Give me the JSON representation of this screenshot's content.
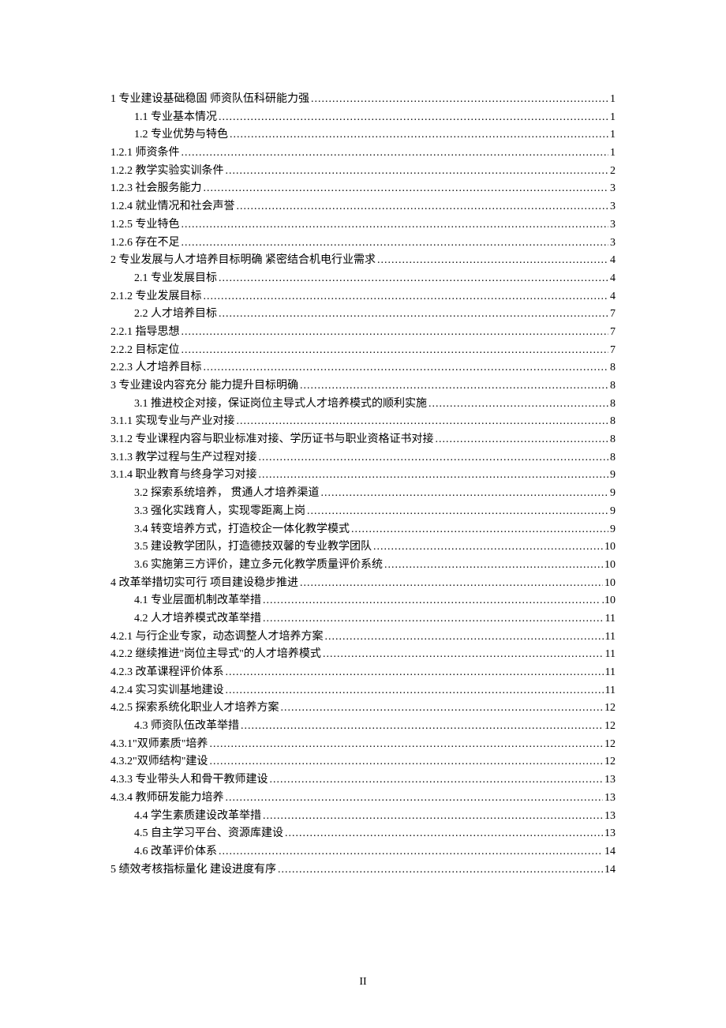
{
  "footer": "II",
  "toc": {
    "entries": [
      {
        "title": "1 专业建设基础稳固  师资队伍科研能力强",
        "page": "1",
        "indent": 0
      },
      {
        "title": "1.1 专业基本情况",
        "page": "1",
        "indent": 1
      },
      {
        "title": "1.2 专业优势与特色",
        "page": "1",
        "indent": 1
      },
      {
        "title": "1.2.1 师资条件",
        "page": "1",
        "indent": 0
      },
      {
        "title": "1.2.2 教学实验实训条件",
        "page": "2",
        "indent": 0
      },
      {
        "title": "1.2.3 社会服务能力",
        "page": "3",
        "indent": 0
      },
      {
        "title": "1.2.4 就业情况和社会声誉",
        "page": "3",
        "indent": 0
      },
      {
        "title": "1.2.5 专业特色",
        "page": "3",
        "indent": 0
      },
      {
        "title": "1.2.6 存在不足",
        "page": "3",
        "indent": 0
      },
      {
        "title": "2 专业发展与人才培养目标明确  紧密结合机电行业需求",
        "page": "4",
        "indent": 0
      },
      {
        "title": "2.1 专业发展目标",
        "page": "4",
        "indent": 1
      },
      {
        "title": "2.1.2 专业发展目标",
        "page": "4",
        "indent": 0
      },
      {
        "title": "2.2 人才培养目标",
        "page": "7",
        "indent": 1
      },
      {
        "title": "2.2.1 指导思想",
        "page": "7",
        "indent": 0
      },
      {
        "title": "2.2.2 目标定位",
        "page": "7",
        "indent": 0
      },
      {
        "title": "2.2.3 人才培养目标",
        "page": "8",
        "indent": 0
      },
      {
        "title": "3 专业建设内容充分  能力提升目标明确",
        "page": "8",
        "indent": 0
      },
      {
        "title": "3.1 推进校企对接，保证岗位主导式人才培养模式的顺利实施",
        "page": "8",
        "indent": 1
      },
      {
        "title": "3.1.1 实现专业与产业对接",
        "page": "8",
        "indent": 0
      },
      {
        "title": "3.1.2 专业课程内容与职业标准对接、学历证书与职业资格证书对接",
        "page": "8",
        "indent": 0
      },
      {
        "title": "3.1.3 教学过程与生产过程对接",
        "page": "8",
        "indent": 0
      },
      {
        "title": "3.1.4 职业教育与终身学习对接",
        "page": "9",
        "indent": 0
      },
      {
        "title": "3.2 探索系统培养，  贯通人才培养渠道",
        "page": "9",
        "indent": 1
      },
      {
        "title": "3.3 强化实践育人，实现零距离上岗",
        "page": "9",
        "indent": 1
      },
      {
        "title": "3.4 转变培养方式，打造校企一体化教学模式",
        "page": "9",
        "indent": 1
      },
      {
        "title": "3.5 建设教学团队，打造德技双馨的专业教学团队",
        "page": "10",
        "indent": 1
      },
      {
        "title": "3.6 实施第三方评价，建立多元化教学质量评价系统",
        "page": "10",
        "indent": 1
      },
      {
        "title": "4 改革举措切实可行  项目建设稳步推进",
        "page": "10",
        "indent": 0
      },
      {
        "title": "4.1 专业层面机制改革举措",
        "page": ".10",
        "indent": 1
      },
      {
        "title": "4.2 人才培养模式改革举措",
        "page": "11",
        "indent": 1
      },
      {
        "title": "4.2.1 与行企业专家，动态调整人才培养方案",
        "page": "11",
        "indent": 0
      },
      {
        "title": "4.2.2 继续推进\"岗位主导式\"的人才培养模式",
        "page": "11",
        "indent": 0
      },
      {
        "title": "4.2.3 改革课程评价体系",
        "page": "11",
        "indent": 0
      },
      {
        "title": "4.2.4 实习实训基地建设",
        "page": "11",
        "indent": 0
      },
      {
        "title": "4.2.5 探索系统化职业人才培养方案",
        "page": "12",
        "indent": 0
      },
      {
        "title": "4.3 师资队伍改革举措",
        "page": "12",
        "indent": 1
      },
      {
        "title": "4.3.1\"双师素质\"培养",
        "page": "12",
        "indent": 0
      },
      {
        "title": "4.3.2\"双师结构\"建设",
        "page": "12",
        "indent": 0
      },
      {
        "title": "4.3.3 专业带头人和骨干教师建设",
        "page": "13",
        "indent": 0
      },
      {
        "title": "4.3.4 教师研发能力培养",
        "page": "13",
        "indent": 0
      },
      {
        "title": "4.4 学生素质建设改革举措",
        "page": "13",
        "indent": 1
      },
      {
        "title": "4.5 自主学习平台、资源库建设",
        "page": "13",
        "indent": 1
      },
      {
        "title": "4.6 改革评价体系",
        "page": "14",
        "indent": 1
      },
      {
        "title": "5 绩效考核指标量化  建设进度有序",
        "page": "14",
        "indent": 0
      }
    ]
  }
}
